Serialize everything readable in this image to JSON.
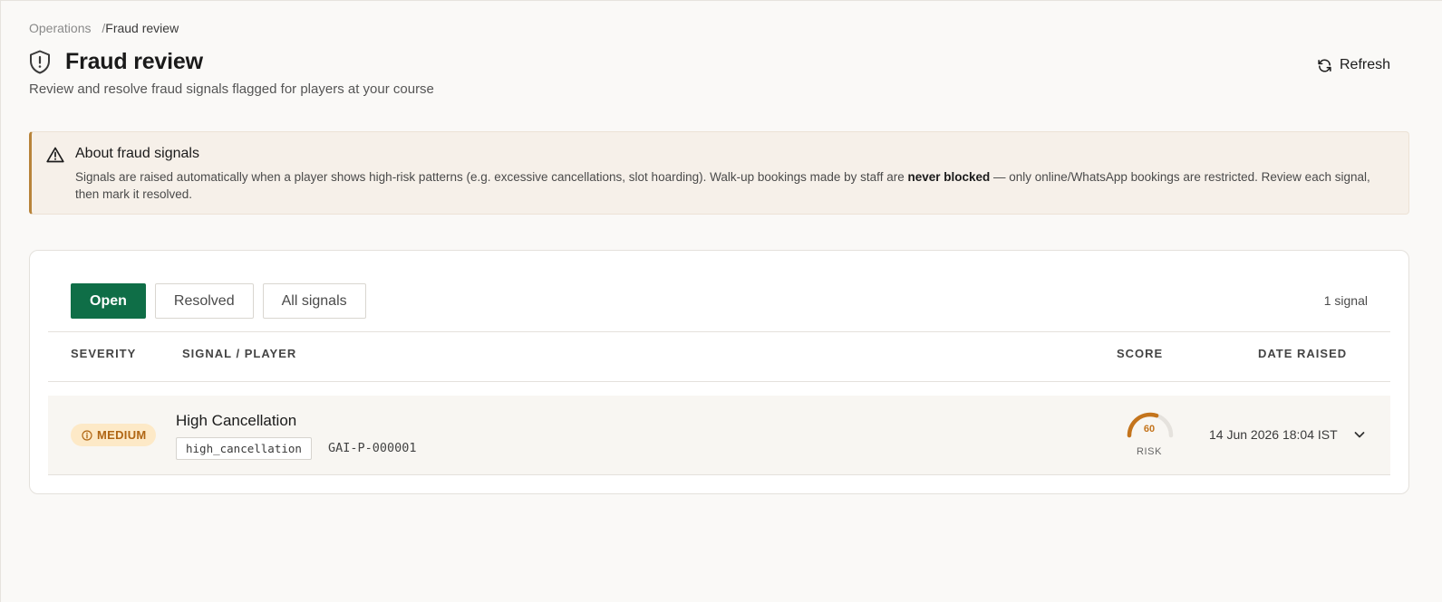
{
  "breadcrumb": {
    "parent": "Operations",
    "separator": "/",
    "current": "Fraud review"
  },
  "header": {
    "title": "Fraud review",
    "subtitle": "Review and resolve fraud signals flagged for players at your course",
    "refresh_label": "Refresh",
    "icon": "shield-alert-icon"
  },
  "notice": {
    "icon": "warning-triangle-icon",
    "title": "About fraud signals",
    "text_before": "Signals are raised automatically when a player shows high-risk patterns (e.g. excessive cancellations, slot hoarding). Walk-up bookings made by staff are ",
    "text_bold": "never blocked",
    "text_after": " — only online/WhatsApp bookings are restricted. Review each signal, then mark it resolved."
  },
  "filters": {
    "tabs": [
      {
        "label": "Open",
        "active": true
      },
      {
        "label": "Resolved",
        "active": false
      },
      {
        "label": "All signals",
        "active": false
      }
    ],
    "count_label": "1 signal"
  },
  "table": {
    "headers": {
      "severity": "SEVERITY",
      "signal": "SIGNAL / PLAYER",
      "score": "SCORE",
      "date": "DATE RAISED"
    },
    "rows": [
      {
        "severity": "MEDIUM",
        "severity_icon": "info-circle-icon",
        "title": "High Cancellation",
        "code": "high_cancellation",
        "player_id": "GAI-P-000001",
        "score": 60,
        "score_max": 100,
        "score_label": "RISK",
        "date": "14 Jun 2026 18:04 IST"
      }
    ]
  },
  "colors": {
    "primary": "#0f6e47",
    "warning_border": "#b8843a",
    "medium_badge_bg": "#fde9c7",
    "medium_badge_text": "#b06614",
    "gauge": "#c4741c"
  }
}
